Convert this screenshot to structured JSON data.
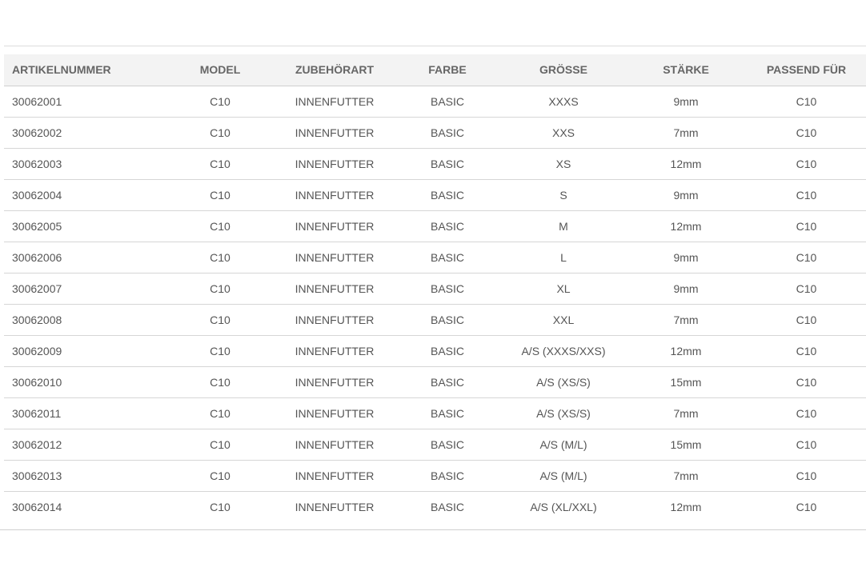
{
  "table": {
    "headers": [
      "ARTIKELNUMMER",
      "MODEL",
      "ZUBEHÖRART",
      "FARBE",
      "GRÖSSE",
      "STÄRKE",
      "PASSEND FÜR"
    ],
    "rows": [
      [
        "30062001",
        "C10",
        "INNENFUTTER",
        "BASIC",
        "XXXS",
        "9mm",
        "C10"
      ],
      [
        "30062002",
        "C10",
        "INNENFUTTER",
        "BASIC",
        "XXS",
        "7mm",
        "C10"
      ],
      [
        "30062003",
        "C10",
        "INNENFUTTER",
        "BASIC",
        "XS",
        "12mm",
        "C10"
      ],
      [
        "30062004",
        "C10",
        "INNENFUTTER",
        "BASIC",
        "S",
        "9mm",
        "C10"
      ],
      [
        "30062005",
        "C10",
        "INNENFUTTER",
        "BASIC",
        "M",
        "12mm",
        "C10"
      ],
      [
        "30062006",
        "C10",
        "INNENFUTTER",
        "BASIC",
        "L",
        "9mm",
        "C10"
      ],
      [
        "30062007",
        "C10",
        "INNENFUTTER",
        "BASIC",
        "XL",
        "9mm",
        "C10"
      ],
      [
        "30062008",
        "C10",
        "INNENFUTTER",
        "BASIC",
        "XXL",
        "7mm",
        "C10"
      ],
      [
        "30062009",
        "C10",
        "INNENFUTTER",
        "BASIC",
        "A/S (XXXS/XXS)",
        "12mm",
        "C10"
      ],
      [
        "30062010",
        "C10",
        "INNENFUTTER",
        "BASIC",
        "A/S (XS/S)",
        "15mm",
        "C10"
      ],
      [
        "30062011",
        "C10",
        "INNENFUTTER",
        "BASIC",
        "A/S (XS/S)",
        "7mm",
        "C10"
      ],
      [
        "30062012",
        "C10",
        "INNENFUTTER",
        "BASIC",
        "A/S (M/L)",
        "15mm",
        "C10"
      ],
      [
        "30062013",
        "C10",
        "INNENFUTTER",
        "BASIC",
        "A/S (M/L)",
        "7mm",
        "C10"
      ],
      [
        "30062014",
        "C10",
        "INNENFUTTER",
        "BASIC",
        "A/S (XL/XXL)",
        "12mm",
        "C10"
      ]
    ]
  },
  "colors": {
    "header_background": "#f3f3f3",
    "text": "#555555",
    "header_text": "#666666",
    "rule": "#d6d6d6"
  }
}
